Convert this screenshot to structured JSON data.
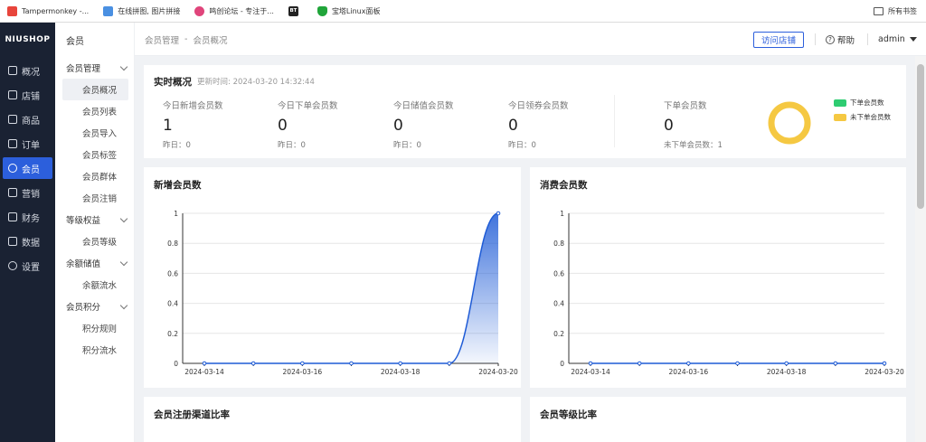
{
  "bookmarks": {
    "items": [
      {
        "label": "Tampermonkey -...",
        "color": "#e8453c"
      },
      {
        "label": "在线拼图, 图片拼接",
        "color": "#4a90e2"
      },
      {
        "label": "鸣创论坛 - 专注于...",
        "color": "#e0457b"
      },
      {
        "label": "宝塔Linux面板",
        "color": "#20a53a"
      }
    ],
    "bt_badge": "BT",
    "all_bookmarks": "所有书签"
  },
  "nav": {
    "logo": "NIUSHOP",
    "items": [
      {
        "label": "概况",
        "icon": "dashboard-icon"
      },
      {
        "label": "店铺",
        "icon": "store-icon"
      },
      {
        "label": "商品",
        "icon": "goods-icon"
      },
      {
        "label": "订单",
        "icon": "order-icon"
      },
      {
        "label": "会员",
        "icon": "member-icon",
        "active": true
      },
      {
        "label": "营销",
        "icon": "marketing-icon"
      },
      {
        "label": "财务",
        "icon": "finance-icon"
      },
      {
        "label": "数据",
        "icon": "data-icon"
      },
      {
        "label": "设置",
        "icon": "settings-icon"
      }
    ]
  },
  "submenu": {
    "title": "会员",
    "groups": [
      {
        "label": "会员管理",
        "items": [
          "会员概况",
          "会员列表",
          "会员导入",
          "会员标签",
          "会员群体",
          "会员注销"
        ]
      },
      {
        "label": "等级权益",
        "items": [
          "会员等级"
        ]
      },
      {
        "label": "余额储值",
        "items": [
          "余额流水"
        ]
      },
      {
        "label": "会员积分",
        "items": [
          "积分规则",
          "积分流水"
        ]
      }
    ]
  },
  "header": {
    "breadcrumb": [
      "会员管理",
      "会员概况"
    ],
    "breadcrumb_sep": "-",
    "visit_store": "访问店铺",
    "help": "帮助",
    "user": "admin"
  },
  "overview": {
    "title": "实时概况",
    "update_label": "更新时间:",
    "update_time": "2024-03-20 14:32:44",
    "stats": [
      {
        "label": "今日新增会员数",
        "value": "1",
        "yesterday": "昨日：0"
      },
      {
        "label": "今日下单会员数",
        "value": "0",
        "yesterday": "昨日：0"
      },
      {
        "label": "今日储值会员数",
        "value": "0",
        "yesterday": "昨日：0"
      },
      {
        "label": "今日领券会员数",
        "value": "0",
        "yesterday": "昨日：0"
      }
    ],
    "order_stat": {
      "label": "下单会员数",
      "value": "0",
      "sub": "未下单会员数：1"
    },
    "donut": {
      "ordered": 0,
      "not_ordered": 1,
      "colors": [
        "#2ecc71",
        "#f5c842"
      ]
    },
    "legend": [
      "下单会员数",
      "未下单会员数"
    ]
  },
  "charts": {
    "new_members": {
      "title": "新增会员数"
    },
    "spend_members": {
      "title": "消费会员数"
    },
    "channel": {
      "title": "会员注册渠道比率"
    },
    "level": {
      "title": "会员等级比率"
    }
  },
  "chart_data": [
    {
      "type": "area",
      "title": "新增会员数",
      "x": [
        "2024-03-14",
        "2024-03-15",
        "2024-03-16",
        "2024-03-17",
        "2024-03-18",
        "2024-03-19",
        "2024-03-20"
      ],
      "x_ticks": [
        "2024-03-14",
        "2024-03-16",
        "2024-03-18",
        "2024-03-20"
      ],
      "values": [
        0,
        0,
        0,
        0,
        0,
        0,
        1
      ],
      "ylim": [
        0,
        1
      ],
      "y_ticks": [
        "0",
        "0.2",
        "0.4",
        "0.6",
        "0.8",
        "1"
      ],
      "color": "#1e5bd6",
      "grid": true
    },
    {
      "type": "line",
      "title": "消费会员数",
      "x": [
        "2024-03-14",
        "2024-03-15",
        "2024-03-16",
        "2024-03-17",
        "2024-03-18",
        "2024-03-19",
        "2024-03-20"
      ],
      "x_ticks": [
        "2024-03-14",
        "2024-03-16",
        "2024-03-18",
        "2024-03-20"
      ],
      "values": [
        0,
        0,
        0,
        0,
        0,
        0,
        0
      ],
      "ylim": [
        0,
        1
      ],
      "y_ticks": [
        "0",
        "0.2",
        "0.4",
        "0.6",
        "0.8",
        "1"
      ],
      "color": "#1e5bd6",
      "grid": true
    }
  ]
}
